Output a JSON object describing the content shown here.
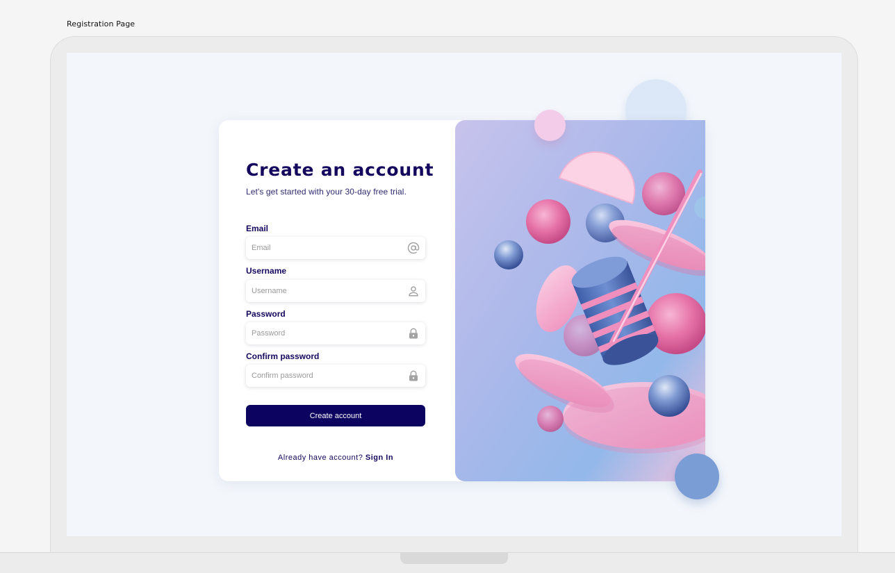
{
  "page_label": "Registration Page",
  "form": {
    "title": "Create an account",
    "subtitle": "Let's get started with your 30-day free trial.",
    "fields": [
      {
        "label": "Email",
        "placeholder": "Email",
        "icon": "at-icon"
      },
      {
        "label": "Username",
        "placeholder": "Username",
        "icon": "user-icon"
      },
      {
        "label": "Password",
        "placeholder": "Password",
        "icon": "lock-icon"
      },
      {
        "label": "Confirm password",
        "placeholder": "Confirm password",
        "icon": "lock-icon"
      }
    ],
    "submit_label": "Create account",
    "signin_prompt": "Already have account?",
    "signin_link": "Sign In"
  },
  "colors": {
    "brand": "#0c0360",
    "heading": "#14075e",
    "screen_bg": "#f3f7fc",
    "accent_pink": "#e96aa5",
    "accent_blue": "#7a9ed8"
  }
}
